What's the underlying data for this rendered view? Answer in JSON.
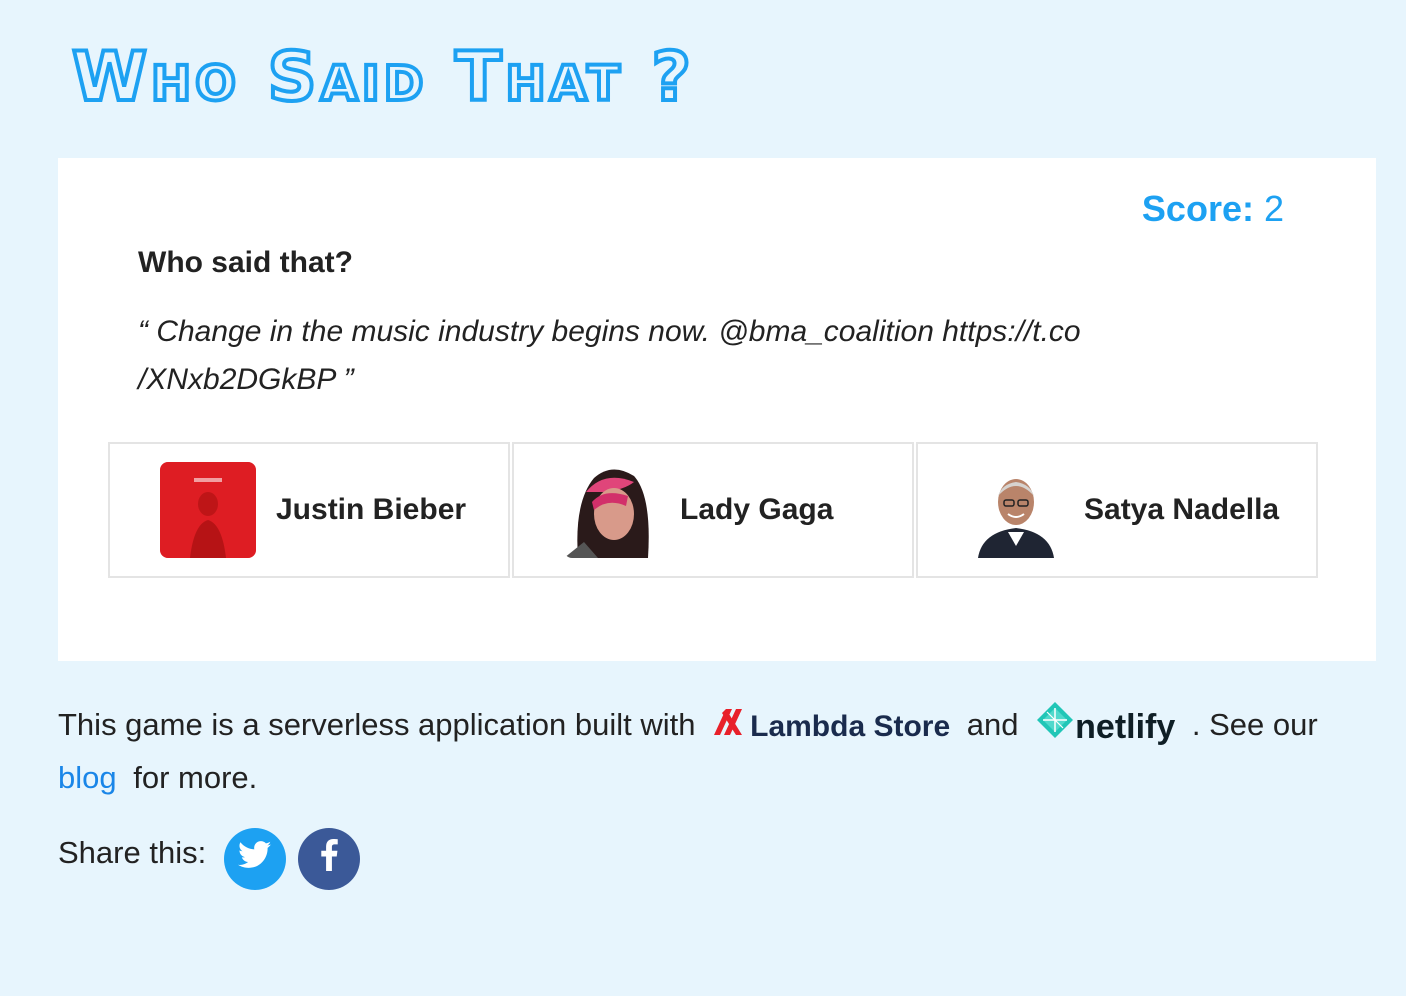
{
  "header": {
    "title": "Who Said That ?"
  },
  "game": {
    "score_label": "Score:",
    "score_value": "2",
    "question": "Who said that?",
    "quote": "“ Change in the music industry begins now. @bma_coalition https://t.co /XNxb2DGkBP ”",
    "options": [
      {
        "label": "Justin Bieber"
      },
      {
        "label": "Lady Gaga"
      },
      {
        "label": "Satya Nadella"
      }
    ]
  },
  "footer": {
    "text_before": "This game is a serverless application built with",
    "lambda_brand": "Lambda Store",
    "and_text": "and",
    "netlify_brand": "netlify",
    "see_text": ". See our",
    "blog_link": "blog",
    "more_text": "for more.",
    "share_label": "Share this:"
  },
  "colors": {
    "accent": "#1da1f2",
    "background": "#e7f5fd",
    "twitter": "#1da1f2",
    "facebook": "#3b5998",
    "lambda_red": "#e8202a",
    "netlify_teal": "#20c6b7"
  },
  "icons": {
    "twitter": "twitter-icon",
    "facebook": "facebook-icon",
    "lambda_store": "lambda-store-logo",
    "netlify": "netlify-logo"
  }
}
